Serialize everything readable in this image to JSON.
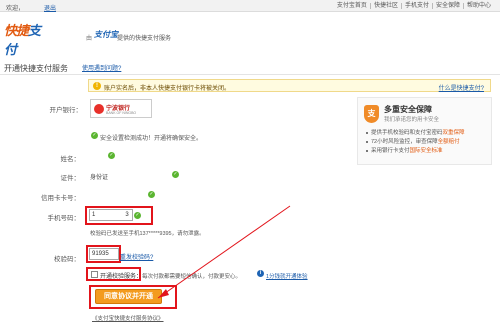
{
  "topbar": {
    "welcome": "欢迎，",
    "logout": "退出",
    "links": [
      "支付宝首页",
      "快捷社区",
      "手机支付",
      "安全保障",
      "帮助中心"
    ]
  },
  "header": {
    "logo_part1": "快捷",
    "logo_part2": "支付",
    "by": "由",
    "brand": "支付宝",
    "tagline": "提供的快捷支付服务"
  },
  "section": {
    "title": "开通快捷支付服务",
    "help_link": "使用遇到问题?"
  },
  "notice": {
    "icon": "!",
    "text": "账户实名后，非本人快捷支付银行卡将被关闭。",
    "link": "什么是快捷支付?"
  },
  "form": {
    "bank_label": "开户银行：",
    "bank_name": "宁波银行",
    "bank_name_en": "BANK OF NINGBO",
    "security_tip": "安全设置检测成功！开通将确保安全。",
    "name_label": "姓名：",
    "id_label": "证件：",
    "id_value": "身份证",
    "card_label": "信用卡卡号：",
    "phone_label": "手机号码：",
    "phone_value": "1",
    "phone_value_suffix": "3",
    "sms_note": "校验码已发送至手机137*****9395，请勿泄露。",
    "code_label": "校验码：",
    "code_value": "91935",
    "resend_link": "重发校验码?",
    "sms_service_label": "开通校验服务：",
    "sms_service_desc": "每次付款都需要短信确认，付款更安心。",
    "experience_link": "1分钱就开通体验",
    "submit_label": "同意协议并开通",
    "agreement": "《支付宝快捷支付服务协议》"
  },
  "side": {
    "icon": "支",
    "title": "多重安全保障",
    "subtitle": "我们承诺您的用卡安全",
    "items": [
      {
        "text": "提供手机校验码和支付宝密码",
        "hl": "双重保障"
      },
      {
        "text": "72小时风险监控，审查保障",
        "hl": "全额赔付"
      },
      {
        "text": "采用银行卡支付",
        "hl": "国际安全标准"
      }
    ]
  },
  "colors": {
    "accent": "#e25b12",
    "brand": "#1e64b4",
    "highlight": "#e2141b",
    "button": "#f39b1f"
  }
}
